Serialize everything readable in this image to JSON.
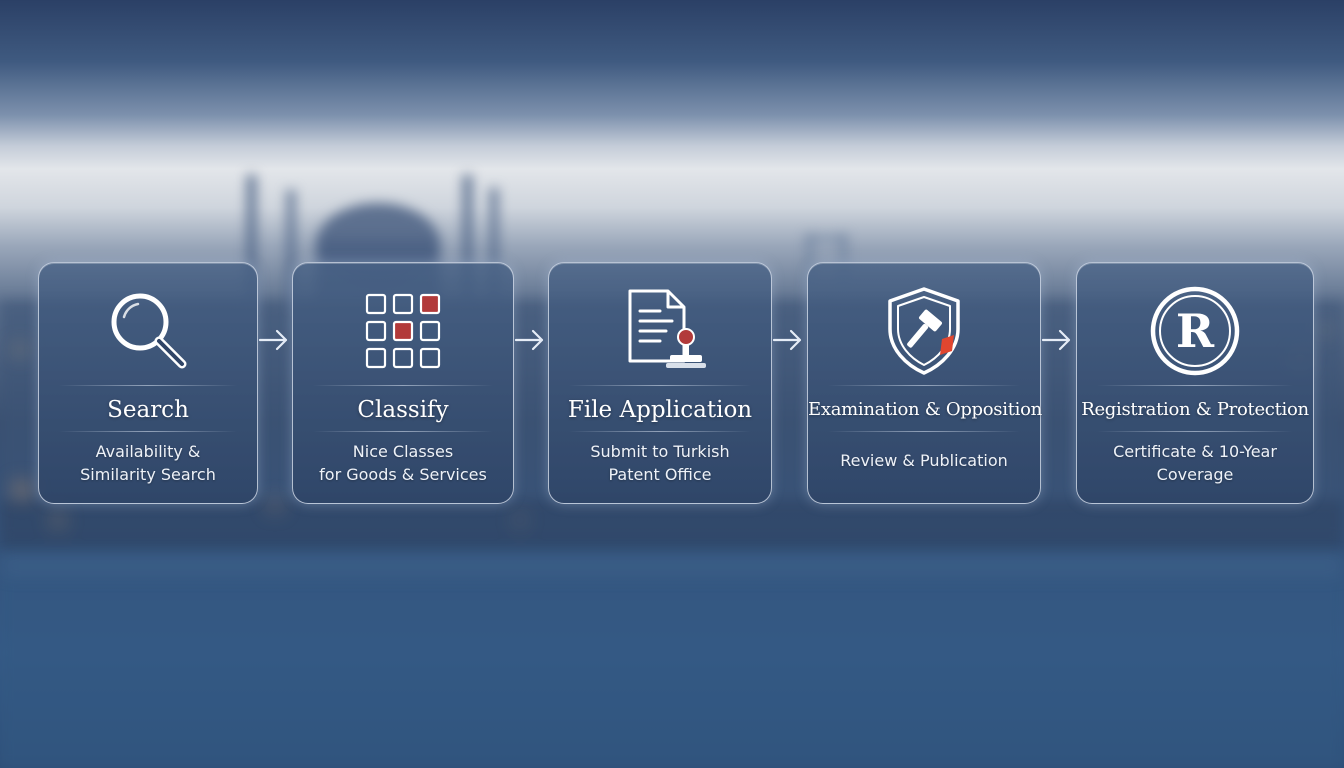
{
  "steps": [
    {
      "title": "Search",
      "description": "Availability &\nSimilarity Search",
      "icon": "magnifying-glass-icon"
    },
    {
      "title": "Classify",
      "description": "Nice Classes\nfor Goods & Services",
      "icon": "grid-icon"
    },
    {
      "title": "File Application",
      "description": "Submit to Turkish\nPatent Office",
      "icon": "document-stamp-icon"
    },
    {
      "title": "Examination & Opposition",
      "description": "Review & Publication",
      "icon": "shield-gavel-icon"
    },
    {
      "title": "Registration & Protection",
      "description": "Certificate & 10-Year\nCoverage",
      "icon": "registered-mark-icon"
    }
  ],
  "colors": {
    "accent_red": "#b23a3a",
    "card_border": "#e1e8f4",
    "text": "#ffffff"
  }
}
